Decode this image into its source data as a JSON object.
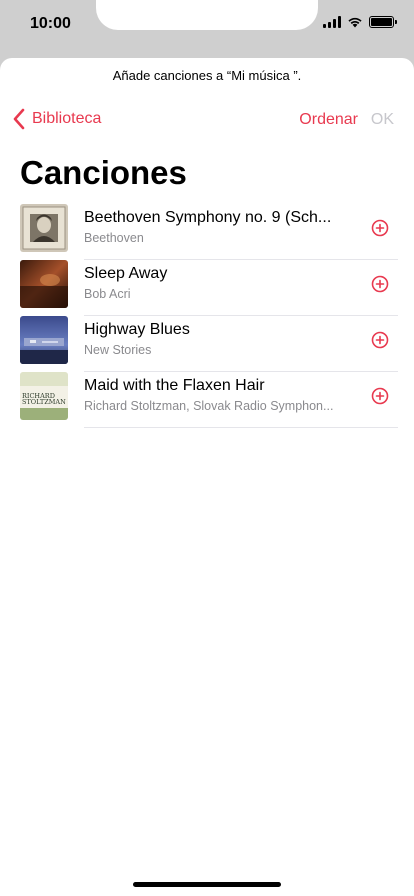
{
  "status": {
    "time": "10:00"
  },
  "sheet": {
    "prompt": "Añade canciones a “Mi música ”.",
    "back_label": "Biblioteca",
    "sort_label": "Ordenar",
    "ok_label": "OK",
    "title": "Canciones"
  },
  "songs": [
    {
      "title": "Beethoven Symphony no. 9 (Sch...",
      "artist": "Beethoven"
    },
    {
      "title": "Sleep Away",
      "artist": "Bob Acri"
    },
    {
      "title": "Highway Blues",
      "artist": "New Stories"
    },
    {
      "title": "Maid with the Flaxen Hair",
      "artist": "Richard Stoltzman, Slovak Radio Symphon..."
    }
  ],
  "album_art_text": {
    "song_4_line1": "RICHARD",
    "song_4_line2": "STOLTZMAN"
  },
  "colors": {
    "accent": "#e8394f",
    "disabled": "#c7c7cc",
    "secondary_text": "#8a8a8e"
  }
}
